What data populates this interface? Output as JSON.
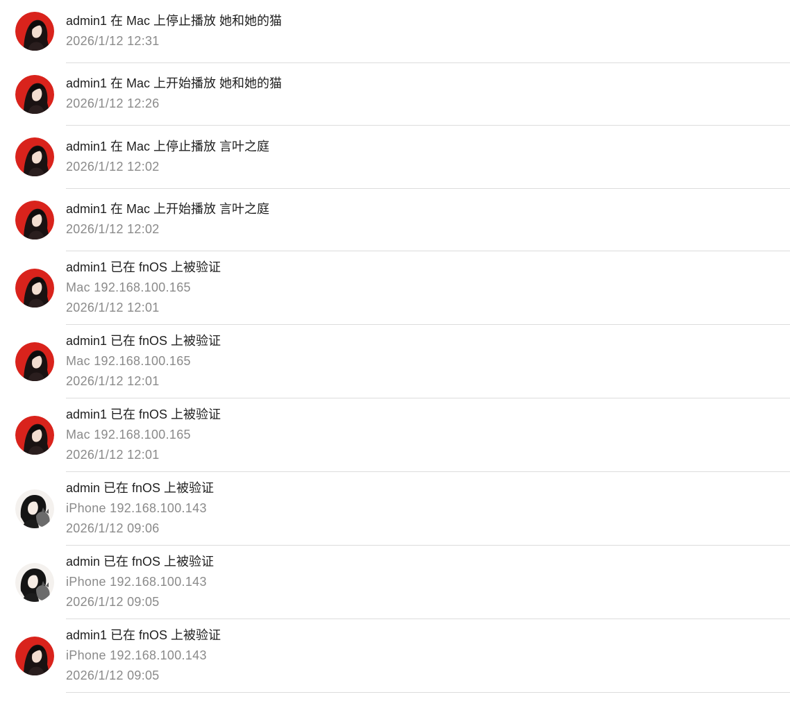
{
  "items": [
    {
      "user": "admin1",
      "avatar": "admin1-avatar",
      "title": "admin1 在 Mac 上停止播放 她和她的猫",
      "device": "",
      "time": "2026/1/12 12:31"
    },
    {
      "user": "admin1",
      "avatar": "admin1-avatar",
      "title": "admin1 在 Mac 上开始播放 她和她的猫",
      "device": "",
      "time": "2026/1/12 12:26"
    },
    {
      "user": "admin1",
      "avatar": "admin1-avatar",
      "title": "admin1 在 Mac 上停止播放 言叶之庭",
      "device": "",
      "time": "2026/1/12 12:02"
    },
    {
      "user": "admin1",
      "avatar": "admin1-avatar",
      "title": "admin1 在 Mac 上开始播放 言叶之庭",
      "device": "",
      "time": "2026/1/12 12:02"
    },
    {
      "user": "admin1",
      "avatar": "admin1-avatar",
      "title": "admin1 已在 fnOS 上被验证",
      "device": "Mac 192.168.100.165",
      "time": "2026/1/12 12:01"
    },
    {
      "user": "admin1",
      "avatar": "admin1-avatar",
      "title": "admin1 已在 fnOS 上被验证",
      "device": "Mac 192.168.100.165",
      "time": "2026/1/12 12:01"
    },
    {
      "user": "admin1",
      "avatar": "admin1-avatar",
      "title": "admin1 已在 fnOS 上被验证",
      "device": "Mac 192.168.100.165",
      "time": "2026/1/12 12:01"
    },
    {
      "user": "admin",
      "avatar": "admin-avatar",
      "title": "admin 已在 fnOS 上被验证",
      "device": "iPhone 192.168.100.143",
      "time": "2026/1/12 09:06"
    },
    {
      "user": "admin",
      "avatar": "admin-avatar",
      "title": "admin 已在 fnOS 上被验证",
      "device": "iPhone 192.168.100.143",
      "time": "2026/1/12 09:05"
    },
    {
      "user": "admin1",
      "avatar": "admin1-avatar",
      "title": "admin1 已在 fnOS 上被验证",
      "device": "iPhone 192.168.100.143",
      "time": "2026/1/12 09:05"
    }
  ],
  "colors": {
    "title": "#1f1f1f",
    "secondary": "#8a8a8a",
    "divider": "#dcdcdc",
    "admin1_avatar_bg": "#d9231c",
    "admin_avatar_bg": "#f4f1ee"
  }
}
